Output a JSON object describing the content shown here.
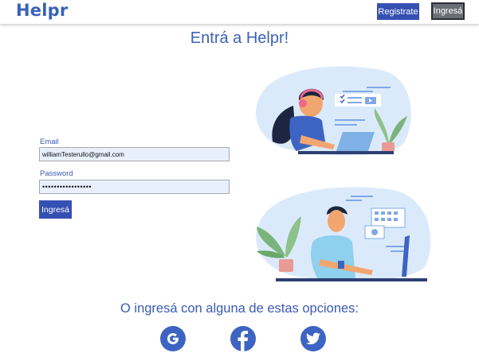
{
  "header": {
    "logo": "Helpr",
    "register_label": "Registrate",
    "login_label": "Ingresá"
  },
  "main": {
    "title": "Entrá a Helpr!",
    "email_label": "Email",
    "email_value": "williamTesterullo@gmail.com",
    "password_label": "Password",
    "password_value": "•••••••••••••••••",
    "submit_label": "Ingresá"
  },
  "alternatives": {
    "text": "O ingresá con alguna de estas opciones:",
    "providers": [
      "google-icon",
      "facebook-icon",
      "twitter-icon"
    ]
  },
  "colors": {
    "brand": "#3b62b8",
    "button": "#3550b3",
    "input_bg": "#e8f0fe"
  }
}
